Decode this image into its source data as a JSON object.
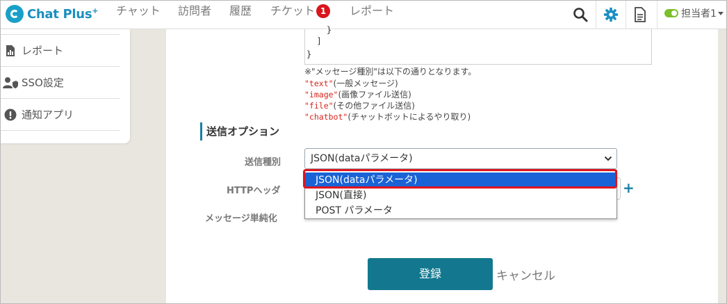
{
  "app": {
    "name": "Chat Plus",
    "name_sup": "+"
  },
  "nav": {
    "items": [
      {
        "label": "チャット"
      },
      {
        "label": "訪問者"
      },
      {
        "label": "履歴"
      },
      {
        "label": "チケット",
        "badge": "1"
      },
      {
        "label": "レポート"
      }
    ],
    "user": "担当者1"
  },
  "sidebar": {
    "items": [
      {
        "label": "レポート",
        "icon": "report-icon"
      },
      {
        "label": "SSO設定",
        "icon": "user-shield-icon"
      },
      {
        "label": "通知アプリ",
        "icon": "exclamation-circle-icon"
      }
    ]
  },
  "code": {
    "lines": [
      "    }",
      "  ]",
      "}"
    ]
  },
  "notes": {
    "intro": "※\"メッセージ種別\"は以下の通りとなります。",
    "types": [
      {
        "code": "\"text\"",
        "desc": "(一般メッセージ)"
      },
      {
        "code": "\"image\"",
        "desc": "(画像ファイル送信)"
      },
      {
        "code": "\"file\"",
        "desc": "(その他ファイル送信)"
      },
      {
        "code": "\"chatbot\"",
        "desc": "(チャットボットによるやり取り)"
      }
    ]
  },
  "form": {
    "section_title": "送信オプション",
    "send_type_label": "送信種別",
    "http_header_label": "HTTPヘッダ",
    "simplify_label": "メッセージ単純化",
    "selected": "JSON(dataパラメータ)",
    "options": [
      "JSON(dataパラメータ)",
      "JSON(直接)",
      "POST パラメータ"
    ],
    "submit": "登録",
    "cancel": "キャンセル"
  },
  "colors": {
    "accent": "#13788f",
    "selected_option": "#1a63d6",
    "highlight": "#e0141c",
    "badge": "#d9161c"
  }
}
